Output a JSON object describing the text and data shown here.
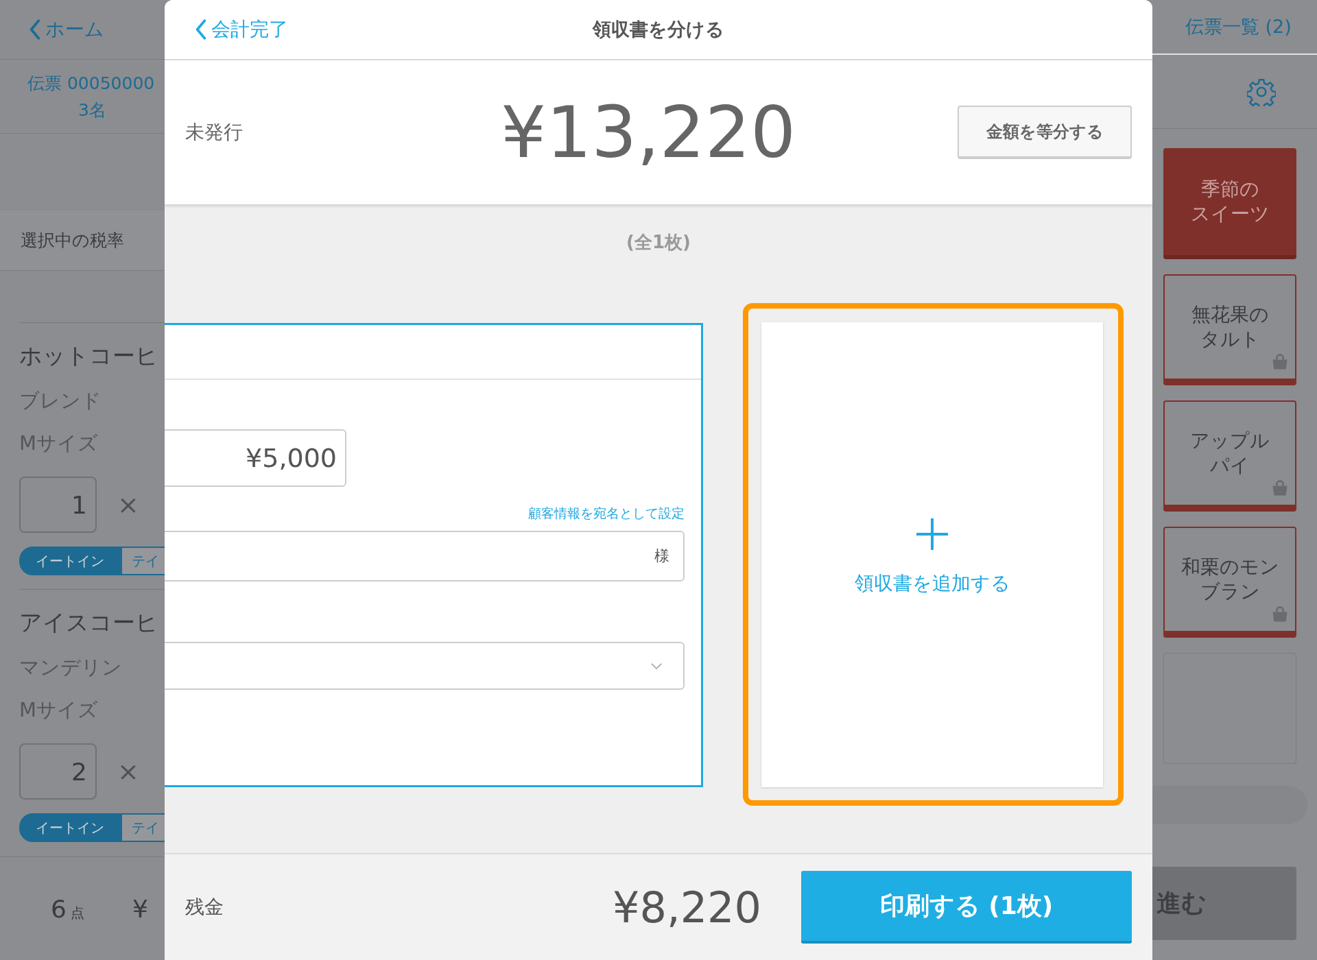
{
  "background_screen": {
    "back_link": "ホーム",
    "list_link": "伝票一覧 (2)",
    "slip": {
      "number": "伝票 00050000",
      "guests": "3名"
    },
    "tax_rate_label": "選択中の税率",
    "order_items": [
      {
        "name": "ホットコーヒ",
        "options": [
          "ブレンド",
          "Mサイズ"
        ],
        "quantity": "1",
        "times": "×",
        "service_toggle": [
          {
            "label": "イートイン",
            "selected": true
          },
          {
            "label": "テイ",
            "selected": false
          }
        ]
      },
      {
        "name": "アイスコーヒ",
        "options": [
          "マンデリン",
          "Mサイズ"
        ],
        "quantity": "2",
        "times": "×",
        "service_toggle": [
          {
            "label": "イートイン",
            "selected": true
          },
          {
            "label": "テイ",
            "selected": false
          }
        ]
      }
    ],
    "item_count": {
      "value": "6",
      "unit": "点"
    },
    "total_partial": "¥",
    "menu_tiles": [
      {
        "kind": "category",
        "lines": [
          "季節の",
          "スイーツ"
        ]
      },
      {
        "kind": "product",
        "lines": [
          "無花果の",
          "タルト"
        ],
        "takeout": true
      },
      {
        "kind": "product",
        "lines": [
          "アップル",
          "パイ"
        ],
        "takeout": true
      },
      {
        "kind": "product",
        "lines": [
          "和栗のモン",
          "ブラン"
        ],
        "takeout": true
      },
      {
        "kind": "empty"
      }
    ],
    "next_button": "進む"
  },
  "modal": {
    "back_link": "会計完了",
    "title": "領収書を分ける",
    "status": "未発行",
    "total": "¥13,220",
    "split_button": "金額を等分する",
    "sheet_count": "(全1枚)",
    "receipts": [
      {
        "amount": "¥5,000",
        "customer_link": "顧客情報を宛名として設定",
        "name_suffix": "様",
        "selected": true
      }
    ],
    "add_receipt": {
      "label": "領収書を追加する",
      "highlighted": true
    },
    "balance_label": "残金",
    "balance": "¥8,220",
    "print_button": "印刷する (1枚)"
  }
}
